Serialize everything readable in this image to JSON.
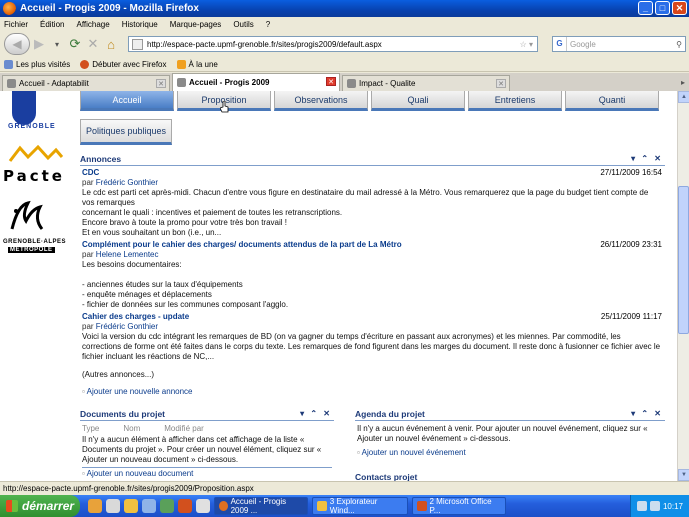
{
  "window": {
    "title": "Accueil - Progis 2009 - Mozilla Firefox"
  },
  "menu": [
    "Fichier",
    "Édition",
    "Affichage",
    "Historique",
    "Marque-pages",
    "Outils",
    "?"
  ],
  "nav": {
    "url": "http://espace-pacte.upmf-grenoble.fr/sites/progis2009/default.aspx",
    "search_placeholder": "Google"
  },
  "bookmarks": [
    "Les plus visités",
    "Débuter avec Firefox",
    "À la une"
  ],
  "tabs": [
    {
      "label": "Accueil - Adaptabilit"
    },
    {
      "label": "Accueil - Progis 2009"
    },
    {
      "label": "Impact - Qualite"
    }
  ],
  "logos": {
    "grenoble": "GRENOBLE",
    "pacte": "Pacte",
    "metro1": "GRENOBLE·ALPES",
    "metro2": "MÉTROPOLE"
  },
  "site_tabs": [
    "Accueil",
    "Proposition",
    "Observations",
    "Quali",
    "Entretiens",
    "Quanti"
  ],
  "site_tab2": "Politiques publiques",
  "annonces": {
    "title": "Annonces",
    "controls": "▾ ⌃ ✕",
    "items": [
      {
        "title": "CDC",
        "date": "27/11/2009 16:54",
        "by_prefix": "par",
        "author": "Frédéric Gonthier",
        "body": "Le cdc est parti cet après-midi. Chacun d'entre vous figure en destinataire du mail adressé à la Métro. Vous remarquerez que la page du budget tient compte de vos remarques\nconcernant le quali : incentives et paiement de toutes les retranscriptions.\nEncore bravo à toute la promo pour votre très bon travail !\nEt en vous souhaitant un bon (i.e., un..."
      },
      {
        "title": "Complément pour le cahier des charges/ documents attendus de la part de La Métro",
        "date": "26/11/2009 23:31",
        "by_prefix": "par",
        "author": "Helene Lementec",
        "body": "Les besoins documentaires:\n\n- anciennes études sur la taux d'équipements\n- enquête ménages et déplacements\n- fichier de données sur les communes composant l'agglo."
      },
      {
        "title": "Cahier des charges - update",
        "date": "25/11/2009 11:17",
        "by_prefix": "par",
        "author": "Frédéric Gonthier",
        "body": "Voici la version du cdc intégrant les remarques de BD (on va gagner du temps d'écriture en passant aux acronymes) et les miennes. Par commodité, les corrections de forme ont été faites dans le corps du texte. Les remarques de fond figurent dans les marges du document. Il reste donc à fusionner ce fichier avec le fichier incluant les réactions de NC,..."
      }
    ],
    "more": "(Autres annonces...)",
    "add": "Ajouter une nouvelle annonce"
  },
  "documents": {
    "title": "Documents du projet",
    "columns": [
      "Type",
      "Nom",
      "Modifié par"
    ],
    "message": "Il n'y a aucun élément à afficher dans cet affichage de la liste « Documents du projet ». Pour créer un nouvel élément, cliquez sur « Ajouter un nouveau document » ci-dessous.",
    "add": "Ajouter un nouveau document"
  },
  "agenda": {
    "title": "Agenda du projet",
    "message": "Il n'y a aucun événement à venir. Pour ajouter un nouvel événement, cliquez sur « Ajouter un nouvel événement » ci-dessous.",
    "add": "Ajouter un nouvel événement"
  },
  "contacts": {
    "title": "Contacts projet"
  },
  "status": "http://espace-pacte.upmf-grenoble.fr/sites/progis2009/Proposition.aspx",
  "taskbar": {
    "start": "démarrer",
    "tasks": [
      "Accueil - Progis 2009 ...",
      "3 Explorateur Wind...",
      "2 Microsoft Office P..."
    ],
    "clock": "10:17"
  }
}
